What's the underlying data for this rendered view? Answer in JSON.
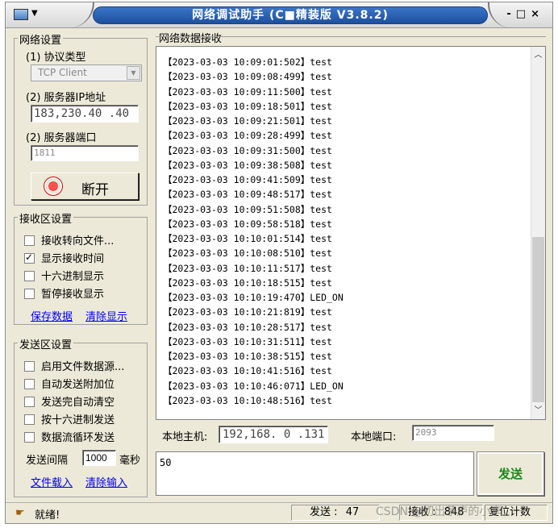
{
  "window": {
    "title": "网络调试助手  (C■精装版 V3.8.2)",
    "controls": [
      "-",
      "□",
      "×"
    ]
  },
  "network_settings": {
    "group_title": "网络设置",
    "protocol_label": "(1) 协议类型",
    "protocol_value": "TCP Client",
    "server_ip_label": "(2) 服务器IP地址",
    "server_ip": [
      "183",
      "230",
      "40",
      "40"
    ],
    "server_port_label": "(2) 服务器端口",
    "server_port": "1811",
    "disconnect_button": "断开"
  },
  "receive_settings": {
    "group_title": "接收区设置",
    "options": [
      {
        "label": "接收转向文件...",
        "checked": false
      },
      {
        "label": "显示接收时间",
        "checked": true
      },
      {
        "label": "十六进制显示",
        "checked": false
      },
      {
        "label": "暂停接收显示",
        "checked": false
      }
    ],
    "save_link": "保存数据",
    "clear_link": "清除显示"
  },
  "send_settings": {
    "group_title": "发送区设置",
    "options": [
      {
        "label": "启用文件数据源...",
        "checked": false
      },
      {
        "label": "自动发送附加位",
        "checked": false
      },
      {
        "label": "发送完自动清空",
        "checked": false
      },
      {
        "label": "按十六进制发送",
        "checked": false
      },
      {
        "label": "数据流循环发送",
        "checked": false
      }
    ],
    "interval_label": "发送间隔",
    "interval_value": "1000",
    "interval_unit": "毫秒",
    "load_file_link": "文件载入",
    "clear_input_link": "清除输入"
  },
  "receive_area": {
    "group_title": "网络数据接收",
    "lines": [
      "【2023-03-03 10:09:01:502】test",
      "【2023-03-03 10:09:08:499】test",
      "【2023-03-03 10:09:11:500】test",
      "【2023-03-03 10:09:18:501】test",
      "【2023-03-03 10:09:21:501】test",
      "【2023-03-03 10:09:28:499】test",
      "【2023-03-03 10:09:31:500】test",
      "【2023-03-03 10:09:38:508】test",
      "【2023-03-03 10:09:41:509】test",
      "【2023-03-03 10:09:48:517】test",
      "【2023-03-03 10:09:51:508】test",
      "【2023-03-03 10:09:58:518】test",
      "【2023-03-03 10:10:01:514】test",
      "【2023-03-03 10:10:08:510】test",
      "【2023-03-03 10:10:11:517】test",
      "【2023-03-03 10:10:18:515】test",
      "【2023-03-03 10:10:19:470】LED_ON",
      "【2023-03-03 10:10:21:819】test",
      "【2023-03-03 10:10:28:517】test",
      "【2023-03-03 10:10:31:511】test",
      "【2023-03-03 10:10:38:515】test",
      "【2023-03-03 10:10:41:516】test",
      "【2023-03-03 10:10:46:071】LED_ON",
      "【2023-03-03 10:10:48:516】test"
    ]
  },
  "local_info": {
    "host_label": "本地主机:",
    "host_ip": [
      "192",
      "168",
      "0",
      "131"
    ],
    "port_label": "本地端口:",
    "port_value": "2093"
  },
  "send_box": {
    "value": "50",
    "send_button": "发送"
  },
  "status_bar": {
    "ready": "就绪!",
    "send_label": "发送",
    "send_count": "47",
    "recv_label": "接收",
    "recv_count": "848",
    "reset_label": "复位计数"
  },
  "watermark": "CSDN @初出茅庐的小李"
}
